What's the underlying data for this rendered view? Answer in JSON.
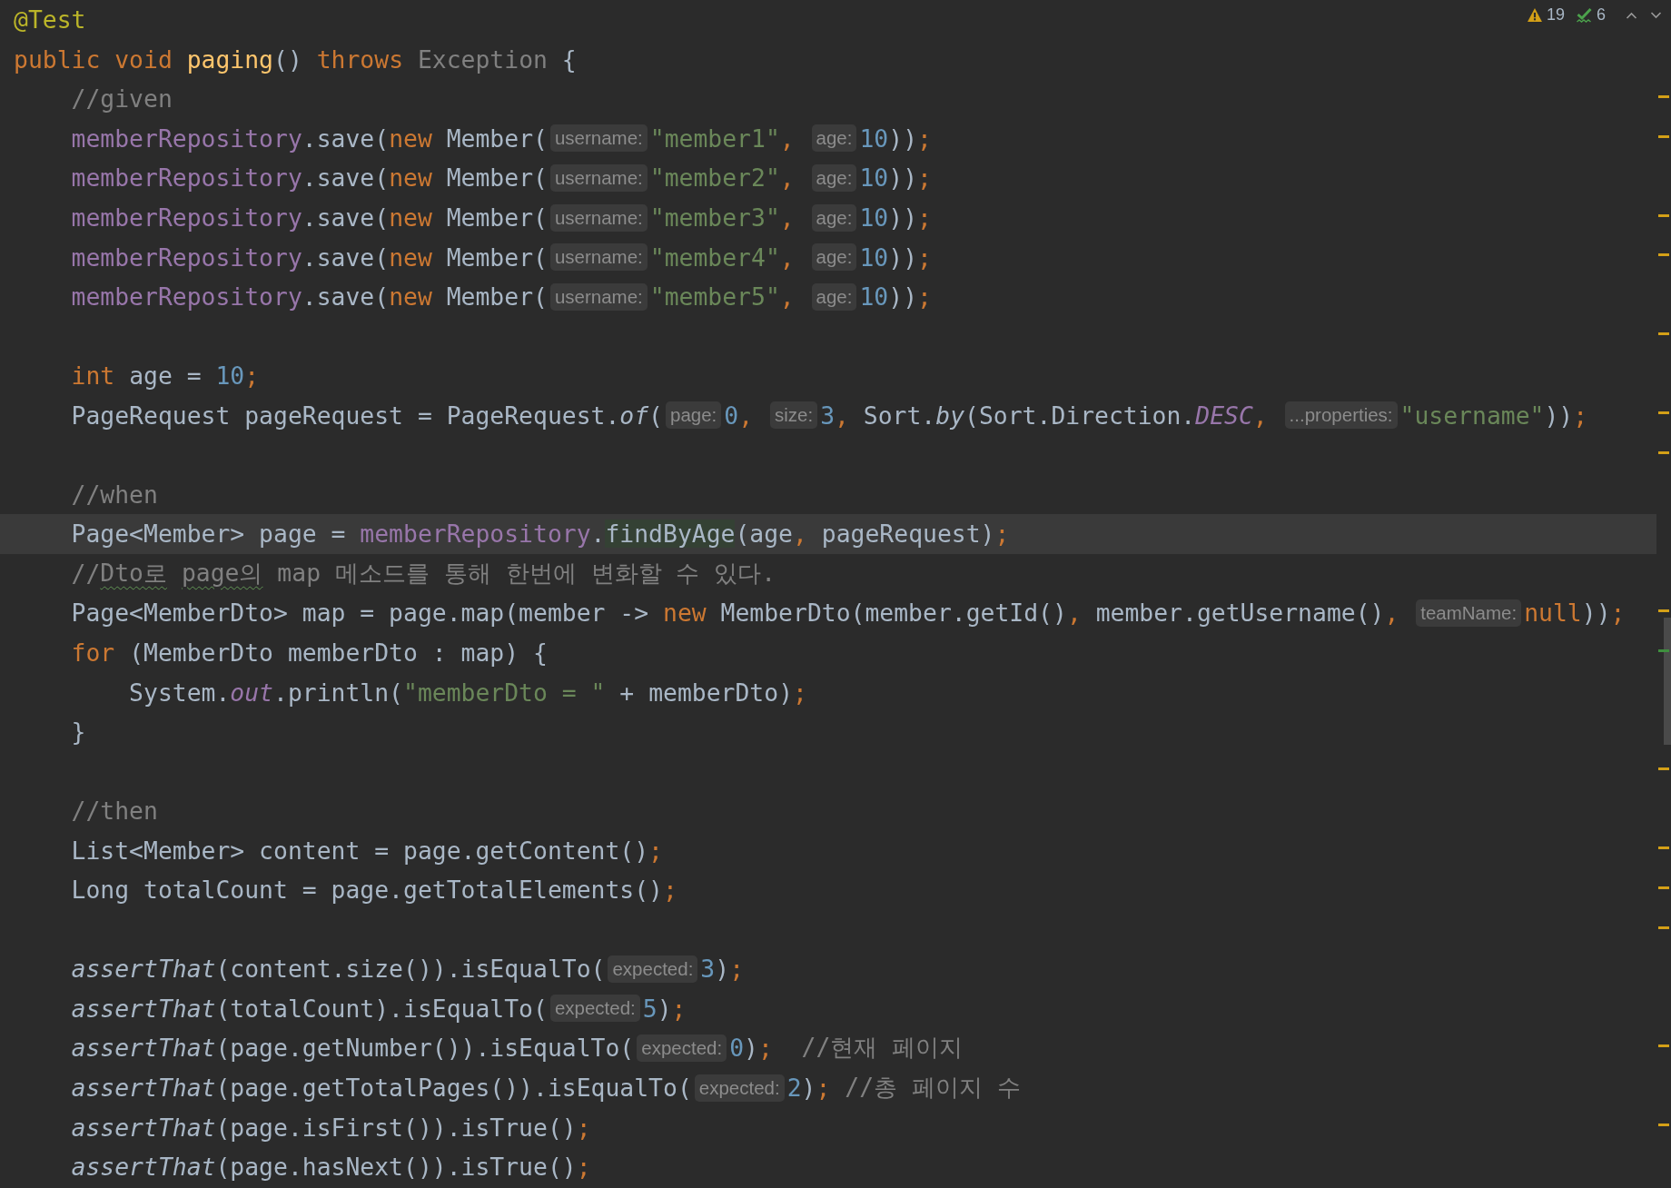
{
  "inspections": {
    "warnings": "19",
    "weak_warnings": "6"
  },
  "lines": [
    {
      "tokens": [
        {
          "kind": "ann",
          "text": "@Test"
        }
      ]
    },
    {
      "tokens": [
        {
          "kind": "kw",
          "text": "public void "
        },
        {
          "kind": "decl",
          "text": "paging"
        },
        {
          "kind": "plain",
          "text": "() "
        },
        {
          "kind": "kw",
          "text": "throws "
        },
        {
          "kind": "unused",
          "text": "Exception"
        },
        {
          "kind": "plain",
          "text": " {"
        }
      ]
    },
    {
      "tokens": [
        {
          "kind": "comment",
          "text": "    //given"
        }
      ],
      "stripe_mark": {
        "color": "#d4a017"
      }
    },
    {
      "tokens": [
        {
          "kind": "field",
          "text": "    memberRepository"
        },
        {
          "kind": "plain",
          "text": ".save("
        },
        {
          "kind": "kw",
          "text": "new "
        },
        {
          "kind": "plain",
          "text": "Member("
        },
        {
          "kind": "hint",
          "text": "username:"
        },
        {
          "kind": "str",
          "text": "\"member1\""
        },
        {
          "kind": "punct",
          "text": ", "
        },
        {
          "kind": "hint",
          "text": "age:"
        },
        {
          "kind": "num",
          "text": "10"
        },
        {
          "kind": "plain",
          "text": "))"
        },
        {
          "kind": "punct",
          "text": ";"
        }
      ],
      "stripe_mark": {
        "color": "#d4a017"
      }
    },
    {
      "tokens": [
        {
          "kind": "field",
          "text": "    memberRepository"
        },
        {
          "kind": "plain",
          "text": ".save("
        },
        {
          "kind": "kw",
          "text": "new "
        },
        {
          "kind": "plain",
          "text": "Member("
        },
        {
          "kind": "hint",
          "text": "username:"
        },
        {
          "kind": "str",
          "text": "\"member2\""
        },
        {
          "kind": "punct",
          "text": ", "
        },
        {
          "kind": "hint",
          "text": "age:"
        },
        {
          "kind": "num",
          "text": "10"
        },
        {
          "kind": "plain",
          "text": "))"
        },
        {
          "kind": "punct",
          "text": ";"
        }
      ]
    },
    {
      "tokens": [
        {
          "kind": "field",
          "text": "    memberRepository"
        },
        {
          "kind": "plain",
          "text": ".save("
        },
        {
          "kind": "kw",
          "text": "new "
        },
        {
          "kind": "plain",
          "text": "Member("
        },
        {
          "kind": "hint",
          "text": "username:"
        },
        {
          "kind": "str",
          "text": "\"member3\""
        },
        {
          "kind": "punct",
          "text": ", "
        },
        {
          "kind": "hint",
          "text": "age:"
        },
        {
          "kind": "num",
          "text": "10"
        },
        {
          "kind": "plain",
          "text": "))"
        },
        {
          "kind": "punct",
          "text": ";"
        }
      ],
      "stripe_mark": {
        "color": "#d4a017"
      }
    },
    {
      "tokens": [
        {
          "kind": "field",
          "text": "    memberRepository"
        },
        {
          "kind": "plain",
          "text": ".save("
        },
        {
          "kind": "kw",
          "text": "new "
        },
        {
          "kind": "plain",
          "text": "Member("
        },
        {
          "kind": "hint",
          "text": "username:"
        },
        {
          "kind": "str",
          "text": "\"member4\""
        },
        {
          "kind": "punct",
          "text": ", "
        },
        {
          "kind": "hint",
          "text": "age:"
        },
        {
          "kind": "num",
          "text": "10"
        },
        {
          "kind": "plain",
          "text": "))"
        },
        {
          "kind": "punct",
          "text": ";"
        }
      ],
      "stripe_mark": {
        "color": "#d4a017"
      }
    },
    {
      "tokens": [
        {
          "kind": "field",
          "text": "    memberRepository"
        },
        {
          "kind": "plain",
          "text": ".save("
        },
        {
          "kind": "kw",
          "text": "new "
        },
        {
          "kind": "plain",
          "text": "Member("
        },
        {
          "kind": "hint",
          "text": "username:"
        },
        {
          "kind": "str",
          "text": "\"member5\""
        },
        {
          "kind": "punct",
          "text": ", "
        },
        {
          "kind": "hint",
          "text": "age:"
        },
        {
          "kind": "num",
          "text": "10"
        },
        {
          "kind": "plain",
          "text": "))"
        },
        {
          "kind": "punct",
          "text": ";"
        }
      ]
    },
    {
      "stripe_mark": {
        "color": "#d4a017"
      }
    },
    {
      "tokens": [
        {
          "kind": "kw",
          "text": "    int "
        },
        {
          "kind": "plain",
          "text": "age = "
        },
        {
          "kind": "num",
          "text": "10"
        },
        {
          "kind": "punct",
          "text": ";"
        }
      ]
    },
    {
      "tokens": [
        {
          "kind": "plain",
          "text": "    PageRequest pageRequest = PageRequest."
        },
        {
          "kind": "smethod",
          "text": "of"
        },
        {
          "kind": "plain",
          "text": "("
        },
        {
          "kind": "hint",
          "text": "page:"
        },
        {
          "kind": "num",
          "text": "0"
        },
        {
          "kind": "punct",
          "text": ", "
        },
        {
          "kind": "hint",
          "text": "size:"
        },
        {
          "kind": "num",
          "text": "3"
        },
        {
          "kind": "punct",
          "text": ", "
        },
        {
          "kind": "plain",
          "text": "Sort."
        },
        {
          "kind": "smethod",
          "text": "by"
        },
        {
          "kind": "plain",
          "text": "(Sort.Direction."
        },
        {
          "kind": "sfield",
          "text": "DESC"
        },
        {
          "kind": "punct",
          "text": ", "
        },
        {
          "kind": "hint",
          "text": "...properties:"
        },
        {
          "kind": "str",
          "text": "\"username\""
        },
        {
          "kind": "plain",
          "text": "))"
        },
        {
          "kind": "punct",
          "text": ";"
        }
      ],
      "stripe_mark": {
        "color": "#d4a017"
      }
    },
    {
      "stripe_mark": {
        "color": "#d4a017"
      }
    },
    {
      "tokens": [
        {
          "kind": "comment",
          "text": "    //when"
        }
      ]
    },
    {
      "tokens": [
        {
          "kind": "plain",
          "text": "    Page<Member> page = "
        },
        {
          "kind": "field",
          "text": "memberRepository"
        },
        {
          "kind": "plain",
          "text": "."
        },
        {
          "kind": "usage",
          "text": "findByAge"
        },
        {
          "kind": "plain",
          "text": "(age"
        },
        {
          "kind": "punct",
          "text": ", "
        },
        {
          "kind": "plain",
          "text": "pageRequest)"
        },
        {
          "kind": "punct",
          "text": ";"
        }
      ],
      "current": true
    },
    {
      "tokens": [
        {
          "kind": "comment",
          "text": "    //"
        },
        {
          "kind": "typo",
          "text": "Dto로"
        },
        {
          "kind": "typo",
          "text": " page의"
        },
        {
          "kind": "comment",
          "text": " map 메소드를 통해 한번에 변화할 수 있다."
        }
      ]
    },
    {
      "tokens": [
        {
          "kind": "plain",
          "text": "    Page<MemberDto> map = page.map(member -> "
        },
        {
          "kind": "kw",
          "text": "new "
        },
        {
          "kind": "plain",
          "text": "MemberDto(member.getId()"
        },
        {
          "kind": "punct",
          "text": ", "
        },
        {
          "kind": "plain",
          "text": "member.getUsername()"
        },
        {
          "kind": "punct",
          "text": ", "
        },
        {
          "kind": "hint",
          "text": "teamName:"
        },
        {
          "kind": "kw",
          "text": "null"
        },
        {
          "kind": "plain",
          "text": "))"
        },
        {
          "kind": "punct",
          "text": ";"
        }
      ],
      "stripe_mark": {
        "color": "#d4a017"
      }
    },
    {
      "tokens": [
        {
          "kind": "kw",
          "text": "    for "
        },
        {
          "kind": "plain",
          "text": "(MemberDto memberDto : map) {"
        }
      ],
      "stripe_mark": {
        "color": "#3e8f3e"
      }
    },
    {
      "tokens": [
        {
          "kind": "plain",
          "text": "        System."
        },
        {
          "kind": "sfield",
          "text": "out"
        },
        {
          "kind": "plain",
          "text": ".println("
        },
        {
          "kind": "str",
          "text": "\"memberDto = \""
        },
        {
          "kind": "plain",
          "text": " + memberDto)"
        },
        {
          "kind": "punct",
          "text": ";"
        }
      ]
    },
    {
      "tokens": [
        {
          "kind": "plain",
          "text": "    }"
        }
      ]
    },
    {
      "stripe_mark": {
        "color": "#d4a017"
      }
    },
    {
      "tokens": [
        {
          "kind": "comment",
          "text": "    //then"
        }
      ]
    },
    {
      "tokens": [
        {
          "kind": "plain",
          "text": "    List<Member> content = page.getContent()"
        },
        {
          "kind": "punct",
          "text": ";"
        }
      ],
      "stripe_mark": {
        "color": "#d4a017"
      }
    },
    {
      "tokens": [
        {
          "kind": "plain",
          "text": "    Long totalCount = page.getTotalElements()"
        },
        {
          "kind": "punct",
          "text": ";"
        }
      ],
      "stripe_mark": {
        "color": "#d4a017"
      }
    },
    {
      "stripe_mark": {
        "color": "#d4a017"
      }
    },
    {
      "tokens": [
        {
          "kind": "smethod",
          "text": "    assertThat"
        },
        {
          "kind": "plain",
          "text": "(content.size()).isEqualTo("
        },
        {
          "kind": "hint",
          "text": "expected:"
        },
        {
          "kind": "num",
          "text": "3"
        },
        {
          "kind": "plain",
          "text": ")"
        },
        {
          "kind": "punct",
          "text": ";"
        }
      ]
    },
    {
      "tokens": [
        {
          "kind": "smethod",
          "text": "    assertThat"
        },
        {
          "kind": "plain",
          "text": "(totalCount).isEqualTo("
        },
        {
          "kind": "hint",
          "text": "expected:"
        },
        {
          "kind": "num",
          "text": "5"
        },
        {
          "kind": "plain",
          "text": ")"
        },
        {
          "kind": "punct",
          "text": ";"
        }
      ]
    },
    {
      "tokens": [
        {
          "kind": "smethod",
          "text": "    assertThat"
        },
        {
          "kind": "plain",
          "text": "(page.getNumber()).isEqualTo("
        },
        {
          "kind": "hint",
          "text": "expected:"
        },
        {
          "kind": "num",
          "text": "0"
        },
        {
          "kind": "plain",
          "text": ")"
        },
        {
          "kind": "punct",
          "text": ";"
        },
        {
          "kind": "comment",
          "text": "  //현재 페이지"
        }
      ],
      "stripe_mark": {
        "color": "#d4a017"
      }
    },
    {
      "tokens": [
        {
          "kind": "smethod",
          "text": "    assertThat"
        },
        {
          "kind": "plain",
          "text": "(page.getTotalPages()).isEqualTo("
        },
        {
          "kind": "hint",
          "text": "expected:"
        },
        {
          "kind": "num",
          "text": "2"
        },
        {
          "kind": "plain",
          "text": ")"
        },
        {
          "kind": "punct",
          "text": ";"
        },
        {
          "kind": "comment",
          "text": " //총 페이지 수"
        }
      ]
    },
    {
      "tokens": [
        {
          "kind": "smethod",
          "text": "    assertThat"
        },
        {
          "kind": "plain",
          "text": "(page.isFirst()).isTrue()"
        },
        {
          "kind": "punct",
          "text": ";"
        }
      ],
      "stripe_mark": {
        "color": "#d4a017"
      }
    },
    {
      "tokens": [
        {
          "kind": "smethod",
          "text": "    assertThat"
        },
        {
          "kind": "plain",
          "text": "(page.hasNext()).isTrue()"
        },
        {
          "kind": "punct",
          "text": ";"
        }
      ]
    }
  ]
}
